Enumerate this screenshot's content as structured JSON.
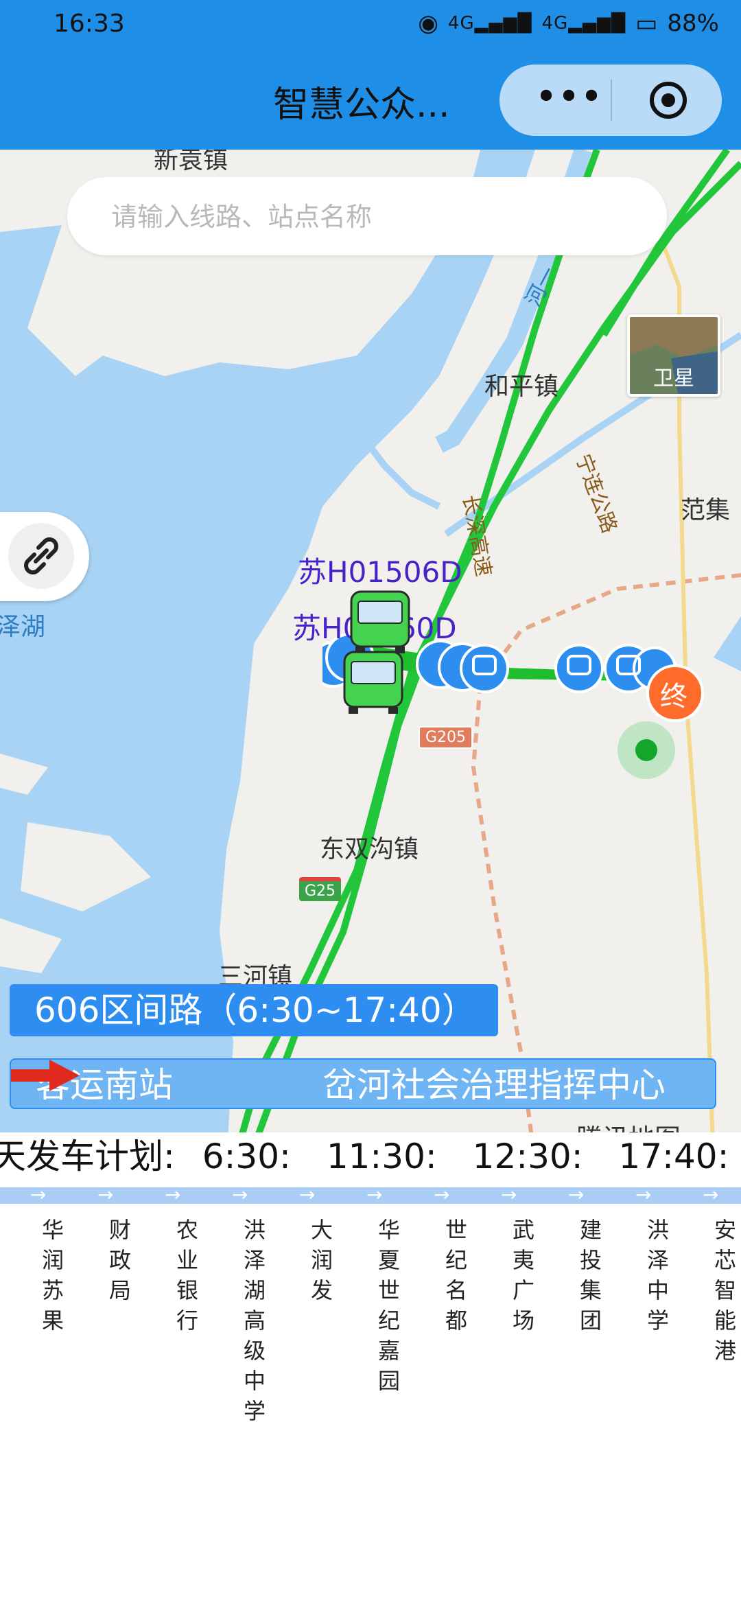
{
  "status": {
    "time": "16:33",
    "network1": "4G",
    "network2": "4G",
    "battery": "88%"
  },
  "app": {
    "title": "智慧公众...",
    "more_label": "•••"
  },
  "search": {
    "placeholder": "请输入线路、站点名称"
  },
  "map": {
    "satellite_label": "卫星",
    "places": {
      "xinyuan": "新袁镇",
      "heping": "和平镇",
      "fanji": "范集",
      "zehu": "泽湖",
      "dongshuanggou": "东双沟镇",
      "sanhe": "三河镇",
      "river": "河一",
      "changshen": "长深高速",
      "ninglian": "宁连公路"
    },
    "highways": {
      "g205": "G205",
      "g25": "G25"
    },
    "terminal": "终",
    "watermark": "腾讯地图",
    "bus_plates": [
      "苏H01506D",
      "苏H01560D"
    ],
    "colors": {
      "route": "#1fbe2e",
      "highway": "#22c63a",
      "water": "#a8d3f5",
      "stop": "#2d8ef0",
      "terminal": "#ff6b2b"
    }
  },
  "route": {
    "name": "606区间路（6:30~17:40）"
  },
  "direction": {
    "from": "客运南站",
    "to": "岔河社会治理指挥中心"
  },
  "plan": {
    "label": "天发车计划:",
    "times": [
      "6:30:",
      "11:30:",
      "12:30:",
      "17:40:"
    ]
  },
  "stops": [
    "华润苏果",
    "财政局",
    "农业银行",
    "洪泽湖高级中学",
    "大润发",
    "华夏世纪嘉园",
    "世纪名都",
    "武夷广场",
    "建投集团",
    "洪泽中学",
    "安芯智能港"
  ]
}
